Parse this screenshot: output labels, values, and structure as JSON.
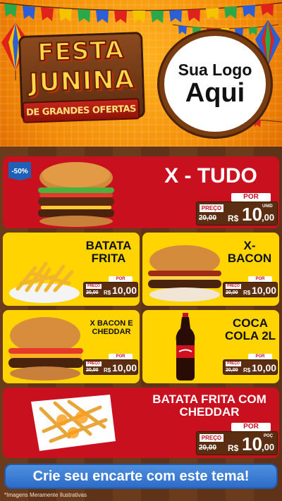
{
  "header": {
    "title_line1": "FESTA",
    "title_line2": "JUNINA",
    "subtitle": "DE GRANDES OFERTAS",
    "logo_line1": "Sua Logo",
    "logo_line2": "Aqui"
  },
  "products": {
    "x_tudo": {
      "badge": "-50%",
      "name": "X - TUDO",
      "por_label": "POR",
      "preco_label": "PREÇO",
      "old_price": "20,00",
      "currency": "R$",
      "price_int": "10",
      "price_dec": ",00",
      "unit": "UNID"
    },
    "batata_frita": {
      "name_l1": "BATATA",
      "name_l2": "FRITA",
      "por_label": "POR",
      "preco_label": "PREÇO",
      "old_price": "20,00",
      "currency": "R$",
      "price": "10,00"
    },
    "x_bacon": {
      "name_l1": "X-",
      "name_l2": "BACON",
      "por_label": "POR",
      "preco_label": "PREÇO",
      "old_price": "20,00",
      "currency": "R$",
      "price": "10,00"
    },
    "x_bacon_cheddar": {
      "name_l1": "X BACON E",
      "name_l2": "CHEDDAR",
      "por_label": "POR",
      "preco_label": "PREÇO",
      "old_price": "20,00",
      "currency": "R$",
      "price": "10,00"
    },
    "coca_cola": {
      "name_l1": "COCA",
      "name_l2": "COLA 2L",
      "por_label": "POR",
      "preco_label": "PREÇO",
      "old_price": "20,00",
      "currency": "R$",
      "price": "10,00"
    },
    "batata_cheddar": {
      "name_l1": "BATATA FRITA COM",
      "name_l2": "CHEDDAR",
      "por_label": "POR",
      "preco_label": "PREÇO",
      "old_price": "20,00",
      "currency": "R$",
      "price_int": "10",
      "price_dec": ",00",
      "unit": "POÇ"
    }
  },
  "cta": {
    "label": "Crie seu encarte com este tema!"
  },
  "footer": {
    "disclaimer": "*Imagens Meramente Ilustrativas"
  },
  "colors": {
    "red": "#c8101e",
    "yellow": "#ffd400",
    "orange": "#f28a07",
    "wood": "#5b2e12",
    "cta_blue": "#2c6cc8"
  }
}
